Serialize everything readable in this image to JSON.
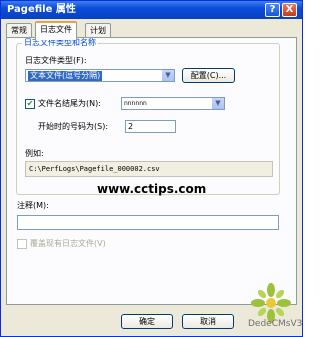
{
  "window": {
    "title": "Pagefile 属性",
    "help_label": "?",
    "close_label": "X"
  },
  "tabs": [
    {
      "label": "常规"
    },
    {
      "label": "日志文件"
    },
    {
      "label": "计划"
    }
  ],
  "group": {
    "title": "日志文件类型和名称",
    "type_label": "日志文件类型(F):",
    "type_value": "文本文件(逗号分隔)",
    "config_button": "配置(C)...",
    "suffix_checkbox_label": "文件名结尾为(N):",
    "suffix_value": "nnnnnn",
    "start_label": "开始时的号码为(S):",
    "start_value": "2",
    "example_label": "例如:",
    "example_value": "C:\\PerfLogs\\Pagefile_000002.csv"
  },
  "watermark": "www.cctips.com",
  "comment": {
    "label": "注释(M):",
    "value": ""
  },
  "overwrite": {
    "label": "覆盖现有日志文件(V)"
  },
  "buttons": {
    "ok": "确定",
    "cancel": "取消"
  },
  "brand": {
    "text": "DedeCMsV3"
  }
}
